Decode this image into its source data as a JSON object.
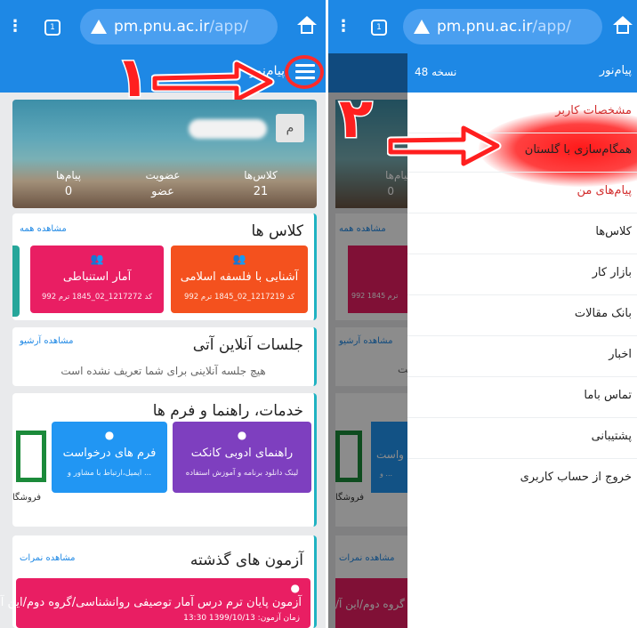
{
  "browser": {
    "url_host": "pm.pnu.ac.ir",
    "url_path": "/app/",
    "tabs_count": "1",
    "icons": [
      "menu-dots-icon",
      "tabs-icon",
      "warning-icon",
      "home-icon"
    ]
  },
  "left": {
    "header_title": "پیام‌نور",
    "step_number": "١",
    "profile": {
      "avatar_letter": "م",
      "stats": [
        {
          "label": "کلاس‌ها",
          "value": "21"
        },
        {
          "label": "عضویت",
          "value": "عضو"
        },
        {
          "label": "پیام‌ها",
          "value": "0"
        }
      ]
    },
    "classes": {
      "title": "کلاس ها",
      "link": "مشاهده همه",
      "cards": [
        {
          "title": "آشنایی با فلسفه اسلامی",
          "code": "کد 1217219_02_1845 ترم 992",
          "color": "#f4511e"
        },
        {
          "title": "آمار استنباطی",
          "code": "کد 1217272_02_1845 ترم 992",
          "color": "#e91e63"
        }
      ]
    },
    "sessions": {
      "title": "جلسات آنلاین آتی",
      "link": "مشاهده آرشیو",
      "empty": "هیچ جلسه آنلاینی برای شما تعریف نشده است"
    },
    "services": {
      "title": "خدمات، راهنما و فرم ها",
      "cards": [
        {
          "title": "راهنمای ادوبی کانکت",
          "sub": "لینک دانلود برنامه و آموزش استفاده",
          "color": "#7e3fbf"
        },
        {
          "title": "فرم های درخواست",
          "sub": "ایمیل،ارتباط با مشاور و ...",
          "color": "#2196f3"
        }
      ],
      "store_label": "فروشگا"
    },
    "exams": {
      "title": "آزمون های گذشته",
      "link": "مشاهده نمرات",
      "exam_title": "آزمون پایان ترم درس آمار توصیفی روانشناسی/گروه دوم/این آ",
      "exam_time": "زمان آزمون: 1399/10/13 13:30"
    }
  },
  "right": {
    "step_number": "٢",
    "drawer_brand": "پیام‌نور",
    "version": "نسخه 48",
    "menu": [
      "مشخصات کاربر",
      "همگام‌سازی با گلستان",
      "پیام‌های من",
      "کلاس‌ها",
      "بازار کار",
      "بانک مقالات",
      "اخبار",
      "تماس باما",
      "پشتیبانی",
      "خروج از حساب کاربری"
    ],
    "behind": {
      "stat_label": "پیام‌ها",
      "stat_value": "0",
      "link_all": "مشاهده همه",
      "code_snip": "992 ترم 1845",
      "link_archive": "مشاهده آرشیو",
      "empty_snip": "است",
      "form_snip": "واست",
      "form_sub_snip": "و ...",
      "store_label": "فروشگا",
      "link_grades": "مشاهده نمرات",
      "exam_snip": "/گروه دوم/این آ"
    }
  },
  "colors": {
    "primary": "#1e88e5",
    "annotation": "#ff1f1f",
    "section_accent": "#20b2c2"
  }
}
